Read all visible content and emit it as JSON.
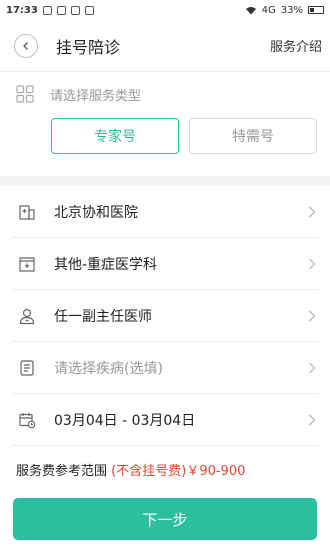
{
  "status_bar": {
    "time": "17:33",
    "network": "4G",
    "battery": "33%"
  },
  "navbar": {
    "title": "挂号陪诊",
    "right_link": "服务介绍"
  },
  "service": {
    "prompt": "请选择服务类型",
    "options": [
      {
        "label": "专家号",
        "selected": true
      },
      {
        "label": "特需号",
        "selected": false
      }
    ]
  },
  "form": {
    "hospital": "北京协和医院",
    "department": "其他-重症医学科",
    "doctor": "任一副主任医师",
    "disease_placeholder": "请选择疾病(选填)",
    "date_range": "03月04日 - 03月04日"
  },
  "fee": {
    "label": "服务费参考范围",
    "note": "(不含挂号费)",
    "range": "￥90-900"
  },
  "actions": {
    "next_label": "下一步"
  },
  "colors": {
    "accent": "#2bbf9f",
    "price_red": "#e8442e"
  },
  "icons": [
    "back-icon",
    "grid-icon",
    "hospital-icon",
    "department-icon",
    "doctor-icon",
    "document-icon",
    "calendar-icon",
    "chevron-right-icon"
  ]
}
